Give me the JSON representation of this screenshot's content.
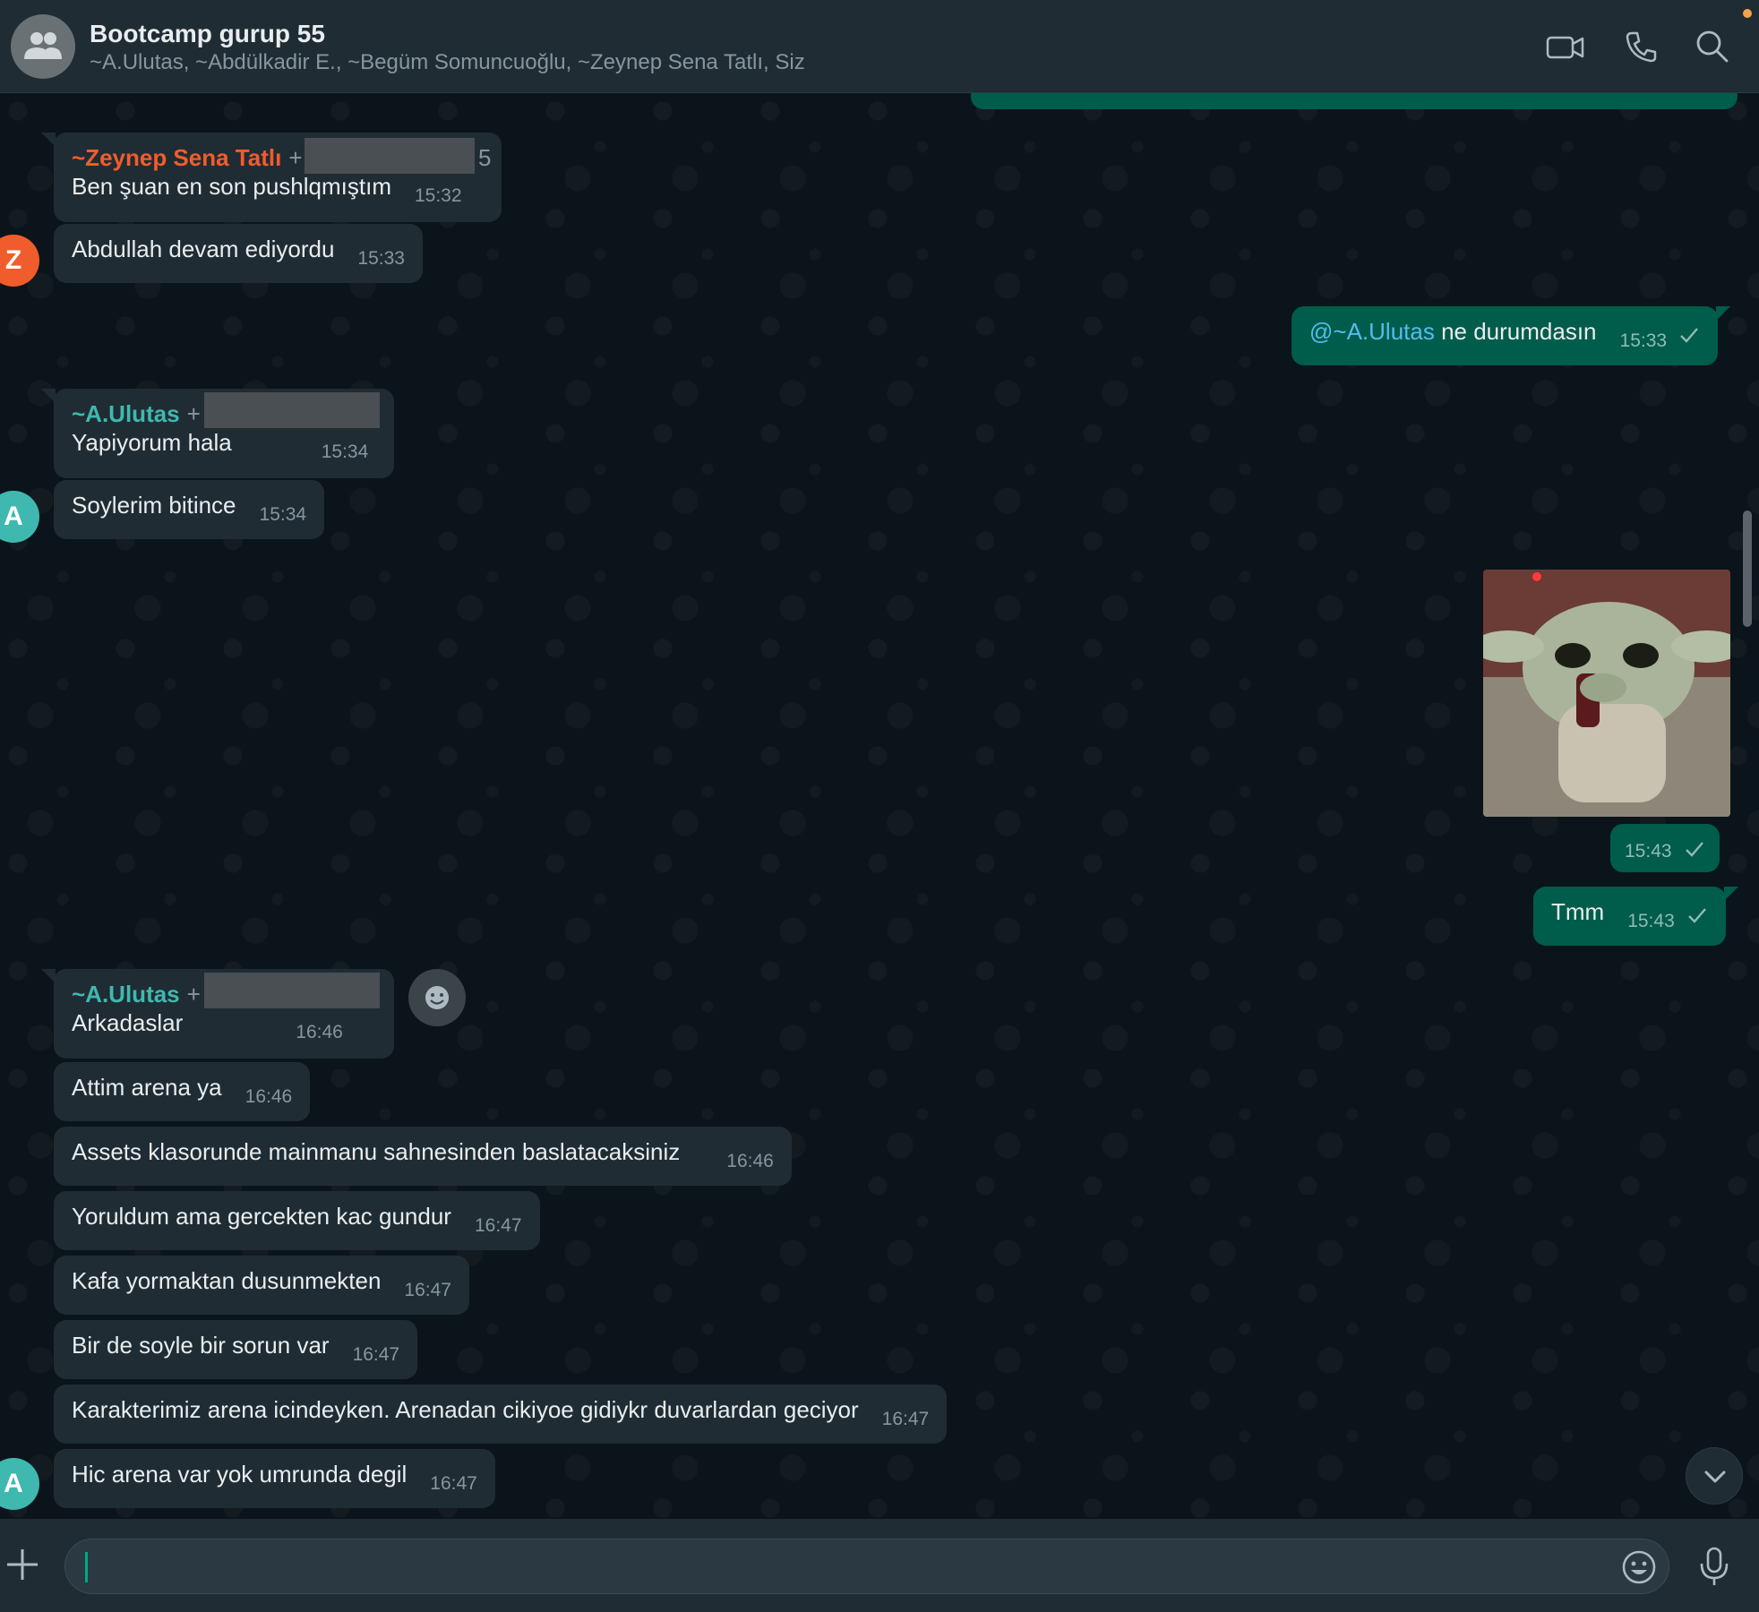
{
  "header": {
    "title": "Bootcamp gurup 55",
    "members": "~A.Ulutas, ~Abdülkadir E., ~Begüm Somuncuoğlu, ~Zeynep Sena Tatlı, Siz"
  },
  "messages": [
    {
      "sender": "~Zeynep Sena Tatlı",
      "sender_prefix": "+",
      "sender_suffix": "5",
      "text": "Ben şuan en son pushlqmıştım",
      "time": "15:32"
    },
    {
      "text": "Abdullah devam ediyordu",
      "time": "15:33",
      "avatar": "Z"
    },
    {
      "mention": "@~A.Ulutas",
      "text": " ne durumdasın",
      "time": "15:33",
      "outgoing": true
    },
    {
      "sender": "~A.Ulutas",
      "sender_prefix": "+",
      "text": "Yapiyorum hala",
      "time": "15:34"
    },
    {
      "text": "Soylerim bitince",
      "time": "15:34",
      "avatar": "A"
    },
    {
      "sticker": "baby-yoda-sticker",
      "time": "15:43",
      "outgoing": true
    },
    {
      "text": "Tmm",
      "time": "15:43",
      "outgoing": true
    },
    {
      "sender": "~A.Ulutas",
      "sender_prefix": "+",
      "text": "Arkadaslar",
      "time": "16:46"
    },
    {
      "text": "Attim arena ya",
      "time": "16:46"
    },
    {
      "text": "Assets klasorunde mainmanu sahnesinden baslatacaksiniz",
      "time": "16:46"
    },
    {
      "text": "Yoruldum ama gercekten kac gundur",
      "time": "16:47"
    },
    {
      "text": "Kafa yormaktan dusunmekten",
      "time": "16:47"
    },
    {
      "text": "Bir de soyle bir sorun var",
      "time": "16:47"
    },
    {
      "text": "Karakterimiz arena icindeyken. Arenadan cikiyoe gidiykr duvarlardan geciyor",
      "time": "16:47"
    },
    {
      "text": "Hic arena var yok umrunda degil",
      "time": "16:47",
      "avatar": "A"
    }
  ],
  "composer": {
    "value": ""
  },
  "colors": {
    "zeynep": "#f15c2c",
    "ulutas": "#3fb8b0",
    "outgoing": "#005c4b",
    "incoming": "#202c33"
  }
}
